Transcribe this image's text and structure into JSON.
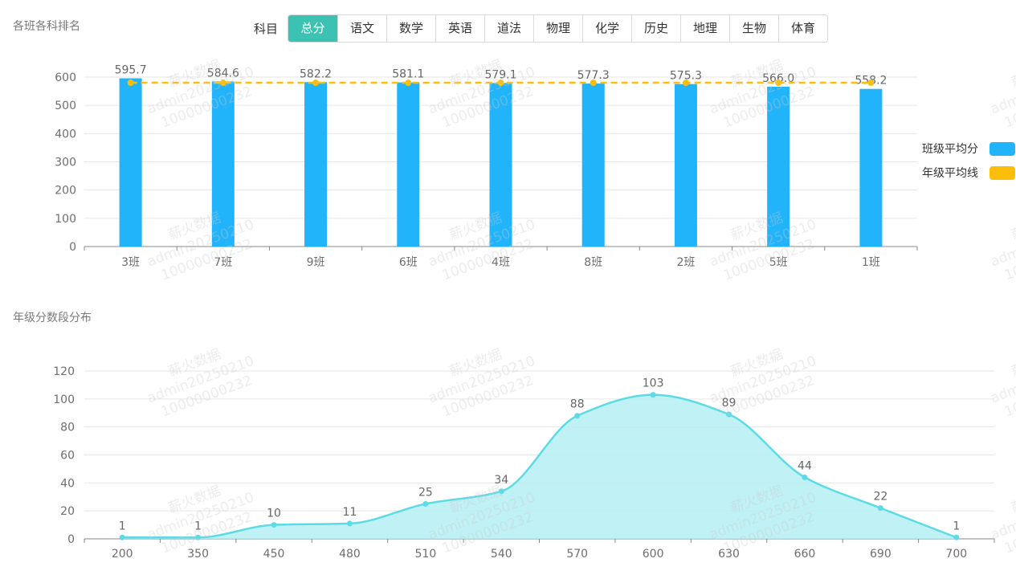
{
  "titles": {
    "ranking": "各班各科排名",
    "distribution": "年级分数段分布"
  },
  "subject_filter": {
    "label": "科目",
    "tabs": [
      "总分",
      "语文",
      "数学",
      "英语",
      "道法",
      "物理",
      "化学",
      "历史",
      "地理",
      "生物",
      "体育"
    ],
    "active_index": 0
  },
  "legend": [
    {
      "label": "班级平均分",
      "color": "#22b4fa"
    },
    {
      "label": "年级平均线",
      "color": "#fbbf0b"
    }
  ],
  "watermark": {
    "lines": [
      "薪火数据",
      "admin20250210",
      "10000000232"
    ]
  },
  "colors": {
    "bar": "#22b4fa",
    "avg_line": "#fbbf0b",
    "area_line": "#5cdbe6",
    "area_fill": "#b5eef3",
    "accent": "#3cc2b2"
  },
  "chart_data": [
    {
      "type": "bar",
      "title": "各班各科排名",
      "categories": [
        "3班",
        "7班",
        "9班",
        "6班",
        "4班",
        "8班",
        "2班",
        "5班",
        "1班"
      ],
      "series": [
        {
          "name": "班级平均分",
          "values": [
            595.7,
            584.6,
            582.2,
            581.1,
            579.1,
            577.3,
            575.3,
            566.0,
            558.2
          ]
        },
        {
          "name": "年级平均线",
          "values": [
            580,
            580,
            580,
            580,
            580,
            580,
            580,
            580,
            580
          ]
        }
      ],
      "value_labels": [
        "595.7",
        "584.6",
        "582.2",
        "581.1",
        "579.1",
        "577.3",
        "575.3",
        "566.0",
        "558.2"
      ],
      "yticks": [
        0,
        100,
        200,
        300,
        400,
        500,
        600
      ],
      "ylim": [
        0,
        600
      ],
      "grid": true,
      "legend_position": "right"
    },
    {
      "type": "area",
      "title": "年级分数段分布",
      "categories": [
        "200",
        "350",
        "450",
        "480",
        "510",
        "540",
        "570",
        "600",
        "630",
        "660",
        "690",
        "700"
      ],
      "values": [
        1,
        1,
        10,
        11,
        25,
        34,
        88,
        103,
        89,
        44,
        22,
        1
      ],
      "yticks": [
        0,
        20,
        40,
        60,
        80,
        100,
        120
      ],
      "ylim": [
        0,
        120
      ],
      "grid": true,
      "smooth": true
    }
  ]
}
